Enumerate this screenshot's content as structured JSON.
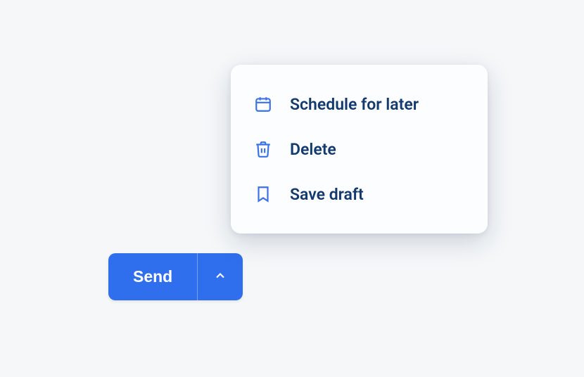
{
  "button": {
    "send_label": "Send"
  },
  "menu": {
    "items": [
      {
        "label": "Schedule for later"
      },
      {
        "label": "Delete"
      },
      {
        "label": "Save draft"
      }
    ]
  }
}
